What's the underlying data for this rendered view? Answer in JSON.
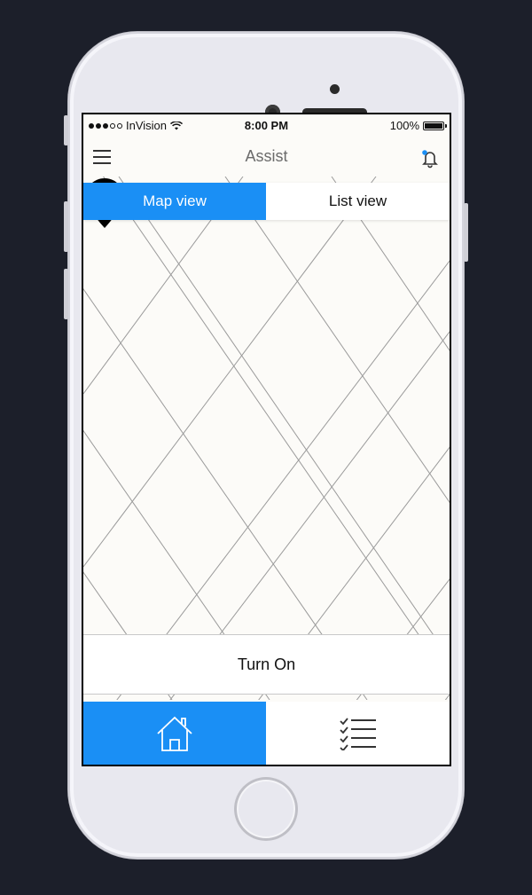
{
  "status_bar": {
    "carrier": "InVision",
    "time": "8:00 PM",
    "battery_percent": "100%"
  },
  "navbar": {
    "title": "Assist",
    "menu_icon": "hamburger-menu-icon",
    "notification_icon": "bell-icon"
  },
  "segments": [
    {
      "label": "Map view",
      "active": true
    },
    {
      "label": "List view",
      "active": false
    }
  ],
  "map": {
    "pin_icon": "location-pin-icon"
  },
  "action": {
    "label": "Turn On"
  },
  "tabbar": {
    "items": [
      {
        "icon": "home-icon",
        "active": true
      },
      {
        "icon": "checklist-icon",
        "active": false
      }
    ]
  },
  "colors": {
    "accent": "#1a8ff5",
    "background": "#1c1f2a",
    "screen": "#fcfbf8"
  }
}
